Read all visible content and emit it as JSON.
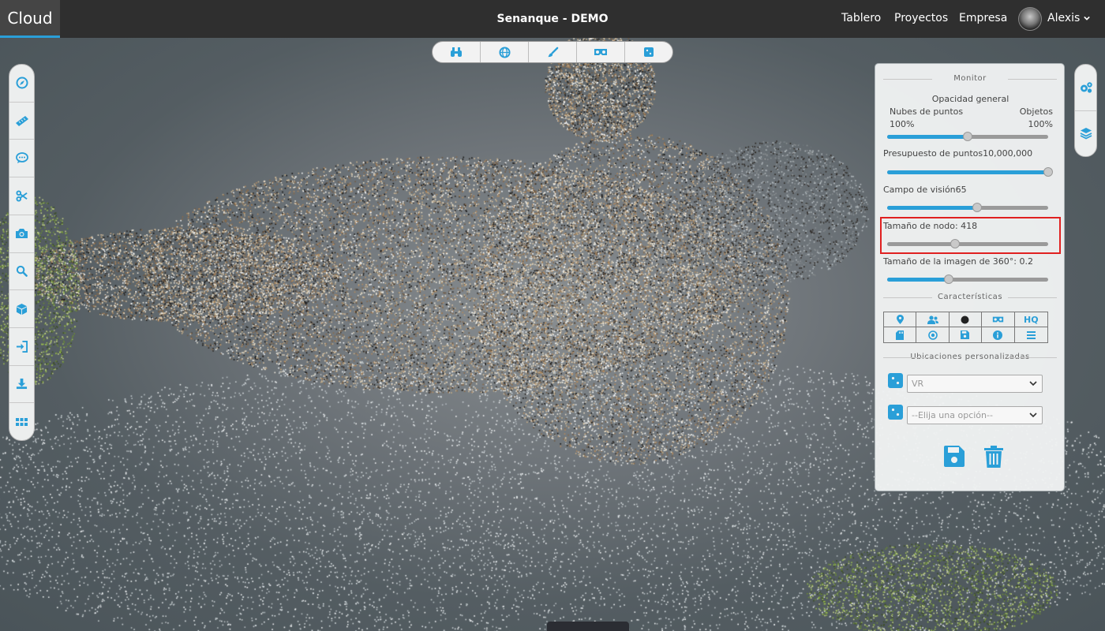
{
  "header": {
    "brand": "Cloud",
    "project_title": "Senanque - DEMO",
    "nav": {
      "dashboard": "Tablero",
      "projects": "Proyectos",
      "company": "Empresa"
    },
    "user_name": "Alexis"
  },
  "colors": {
    "accent": "#2a9fd8",
    "topbar": "#2f2f2f",
    "highlight": "#e02020"
  },
  "top_toolbar": [
    "binoculars-icon",
    "globe-icon",
    "brush-icon",
    "vr-goggles-icon",
    "cube-icon"
  ],
  "left_toolbar": [
    "compass-icon",
    "ruler-icon",
    "comment-icon",
    "scissors-icon",
    "camera-icon",
    "search-icon",
    "cube-icon",
    "sign-in-icon",
    "download-icon",
    "grid-icon"
  ],
  "right_toolbar": [
    "cogs-icon",
    "layers-icon"
  ],
  "monitor": {
    "title": "Monitor",
    "general_opacity": {
      "label": "Opacidad general",
      "left_label": "Nubes de puntos",
      "right_label": "Objetos",
      "left_value": "100%",
      "right_value": "100%",
      "position": 0.5
    },
    "point_budget": {
      "label": "Presupuesto de puntos",
      "value": "10,000,000",
      "position": 1.0
    },
    "fov": {
      "label": "Campo de visión",
      "value": "65",
      "position": 0.56
    },
    "node_size": {
      "label": "Tamaño de nodo: ",
      "value": "418",
      "position": 0.42
    },
    "image360_size": {
      "label": "Tamaño de la imagen de 360°: ",
      "value": "0.2",
      "position": 0.38
    },
    "features_title": "Características",
    "features": [
      "map-marker-icon",
      "users-icon",
      "circle-icon",
      "vr-goggles-icon",
      "HQ",
      "sd-card-icon",
      "registered-icon",
      "save-icon",
      "info-icon",
      "list-icon"
    ],
    "custom_locations_title": "Ubicaciones personalizadas",
    "location_select_1": "VR",
    "location_select_2": "--Elija una opción--"
  }
}
